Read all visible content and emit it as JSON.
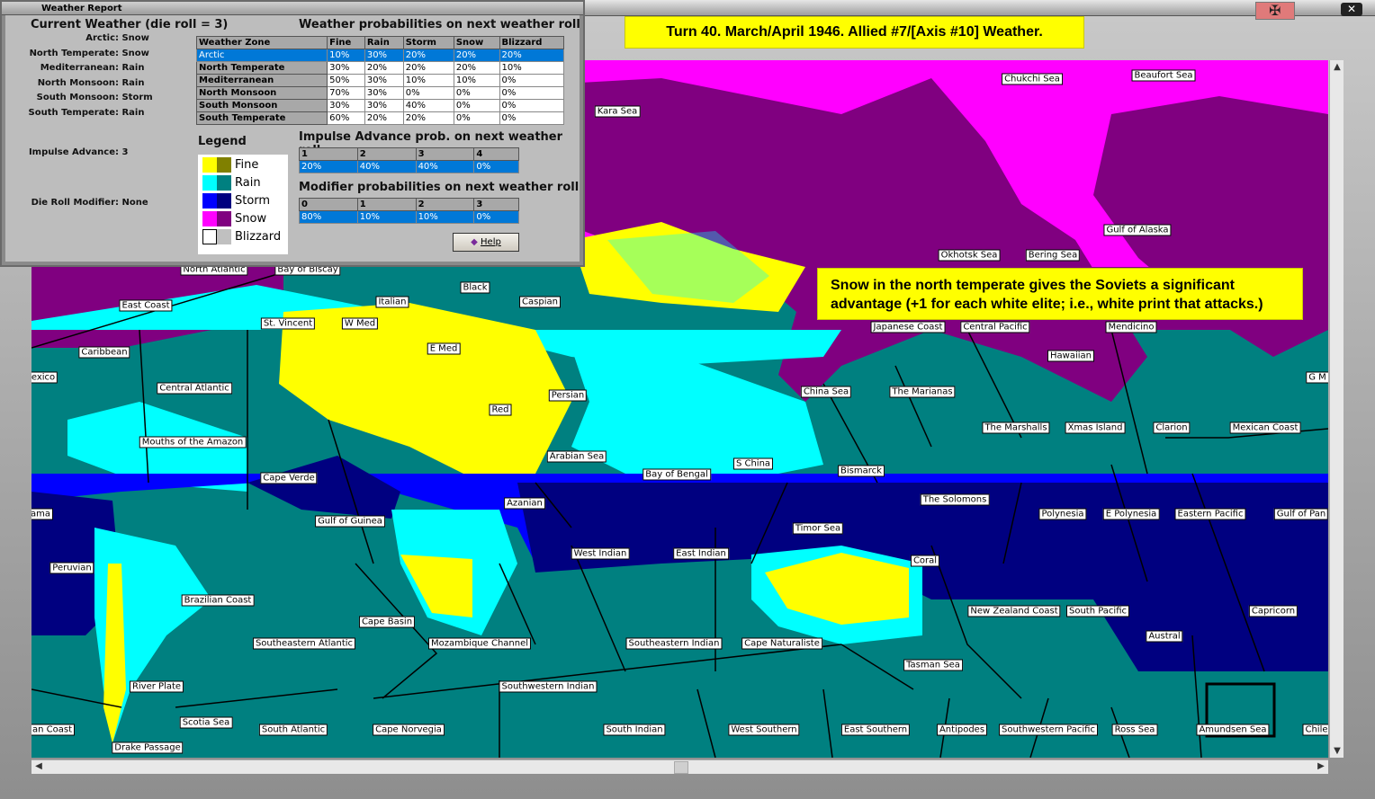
{
  "window": {
    "title": "Weather Report"
  },
  "report": {
    "current_heading": "Current Weather (die roll = 3)",
    "current": [
      {
        "zone": "Arctic:",
        "weather": "Snow"
      },
      {
        "zone": "North Temperate:",
        "weather": "Snow"
      },
      {
        "zone": "Mediterranean:",
        "weather": "Rain"
      },
      {
        "zone": "North Monsoon:",
        "weather": "Rain"
      },
      {
        "zone": "South Monsoon:",
        "weather": "Storm"
      },
      {
        "zone": "South Temperate:",
        "weather": "Rain"
      }
    ],
    "impulse_advance": {
      "label": "Impulse Advance:",
      "value": "3"
    },
    "die_roll_modifier": {
      "label": "Die Roll Modifier:",
      "value": "None"
    },
    "prob_heading": "Weather probabilities on next weather roll",
    "prob_headers": [
      "Weather Zone",
      "Fine",
      "Rain",
      "Storm",
      "Snow",
      "Blizzard"
    ],
    "prob_rows": [
      [
        "Arctic",
        "10%",
        "30%",
        "20%",
        "20%",
        "20%"
      ],
      [
        "North Temperate",
        "30%",
        "20%",
        "20%",
        "20%",
        "10%"
      ],
      [
        "Mediterranean",
        "50%",
        "30%",
        "10%",
        "10%",
        "0%"
      ],
      [
        "North Monsoon",
        "70%",
        "30%",
        "0%",
        "0%",
        "0%"
      ],
      [
        "South Monsoon",
        "30%",
        "30%",
        "40%",
        "0%",
        "0%"
      ],
      [
        "South Temperate",
        "60%",
        "20%",
        "20%",
        "0%",
        "0%"
      ]
    ],
    "legend_heading": "Legend",
    "legend": [
      {
        "label": "Fine",
        "colors": [
          "#ffff00",
          "#808000"
        ]
      },
      {
        "label": "Rain",
        "colors": [
          "#00ffff",
          "#008080"
        ]
      },
      {
        "label": "Storm",
        "colors": [
          "#0000ff",
          "#000080"
        ]
      },
      {
        "label": "Snow",
        "colors": [
          "#ff00ff",
          "#800080"
        ]
      },
      {
        "label": "Blizzard",
        "colors": [
          "#ffffff",
          "#c0c0c0"
        ]
      }
    ],
    "impulse_heading": "Impulse Advance prob. on next weather roll",
    "impulse_headers": [
      "1",
      "2",
      "3",
      "4"
    ],
    "impulse_values": [
      "20%",
      "40%",
      "40%",
      "0%"
    ],
    "modifier_heading": "Modifier probabilities on next weather roll",
    "modifier_headers": [
      "0",
      "1",
      "2",
      "3"
    ],
    "modifier_values": [
      "80%",
      "10%",
      "10%",
      "0%"
    ],
    "help_label": "Help"
  },
  "callouts": {
    "turn": "Turn 40.  March/April 1946.  Allied #7/[Axis #10]  Weather.",
    "note_line1": "Snow in the north temperate gives the Soviets a significant",
    "note_line2": "advantage (+1 for each white elite; i.e., white print that attacks.)"
  },
  "map": {
    "labels": [
      "Chukchi Sea",
      "Beaufort Sea",
      "Kara Sea",
      "Gulf of Alaska",
      "Okhotsk Sea",
      "Bering Sea",
      "North Atlantic",
      "Bay of Biscay",
      "Black",
      "Caspian",
      "Italian",
      "East Coast",
      "St. Vincent",
      "W Med",
      "Japanese Coast",
      "Central Pacific",
      "Mendicino",
      "E Med",
      "Caribbean",
      "Hawaiian",
      "exico",
      "G M",
      "Central Atlantic",
      "China Sea",
      "The Marianas",
      "Persian",
      "Red",
      "The Marshalls",
      "Xmas Island",
      "Clarion",
      "Mexican Coast",
      "Mouths of the Amazon",
      "Arabian Sea",
      "S China",
      "Bay of Bengal",
      "Bismarck",
      "Cape Verde",
      "The Solomons",
      "Azanian",
      "ama",
      "Gulf of Guinea",
      "Polynesia",
      "E Polynesia",
      "Eastern Pacific",
      "Gulf of Pan",
      "Timor Sea",
      "West Indian",
      "East Indian",
      "Coral",
      "Peruvian",
      "Brazilian Coast",
      "New Zealand Coast",
      "South Pacific",
      "Capricorn",
      "Cape Basin",
      "Austral",
      "Southeastern Atlantic",
      "Mozambique Channel",
      "Southeastern Indian",
      "Cape Naturaliste",
      "Tasman Sea",
      "Southwestern Indian",
      "River Plate",
      "Scotia Sea",
      "an Coast",
      "South Atlantic",
      "Cape Norvegia",
      "South Indian",
      "West Southern",
      "East Southern",
      "Antipodes",
      "Southwestern Pacific",
      "Ross Sea",
      "Amundsen Sea",
      "Chile",
      "Drake Passage"
    ]
  }
}
